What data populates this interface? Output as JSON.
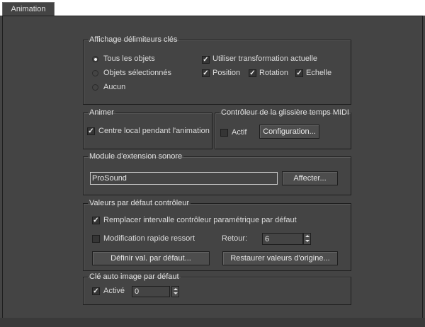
{
  "tab": {
    "label": "Animation"
  },
  "key_bracket": {
    "title": "Affichage délimiteurs clés",
    "radio_all": "Tous les objets",
    "radio_selected": "Objets sélectionnés",
    "radio_none": "Aucun",
    "selected_radio": "all",
    "use_current_transform": {
      "label": "Utiliser transformation actuelle",
      "checked": true
    },
    "position": {
      "label": "Position",
      "checked": true
    },
    "rotation": {
      "label": "Rotation",
      "checked": true
    },
    "scale": {
      "label": "Echelle",
      "checked": true
    }
  },
  "animate": {
    "title": "Animer",
    "local_center": {
      "label": "Centre local pendant l'animation",
      "checked": true
    }
  },
  "midi": {
    "title": "Contrôleur de la glissière temps MIDI",
    "enable": {
      "label": "Actif",
      "checked": false
    },
    "setup_button": "Configuration..."
  },
  "sound": {
    "title": "Module d'extension sonore",
    "plugin_value": "ProSound",
    "assign_button": "Affecter..."
  },
  "controller_defaults": {
    "title": "Valeurs par défaut contrôleur",
    "override_range": {
      "label": "Remplacer intervalle contrôleur paramétrique par défaut",
      "checked": true
    },
    "spring_quick_edit": {
      "label": "Modification rapide ressort",
      "checked": false
    },
    "rollback_label": "Retour:",
    "rollback_value": "6",
    "set_defaults_button": "Définir val. par défaut...",
    "restore_button": "Restaurer valeurs d'origine..."
  },
  "auto_key": {
    "title": "Clé auto image par défaut",
    "enabled": {
      "label": "Activé",
      "checked": true
    },
    "frame_value": "0"
  },
  "colors": {
    "background": "#444444",
    "border": "#1e1e1e",
    "tab_strip": "#ffffff",
    "text": "#dcdcdc"
  }
}
